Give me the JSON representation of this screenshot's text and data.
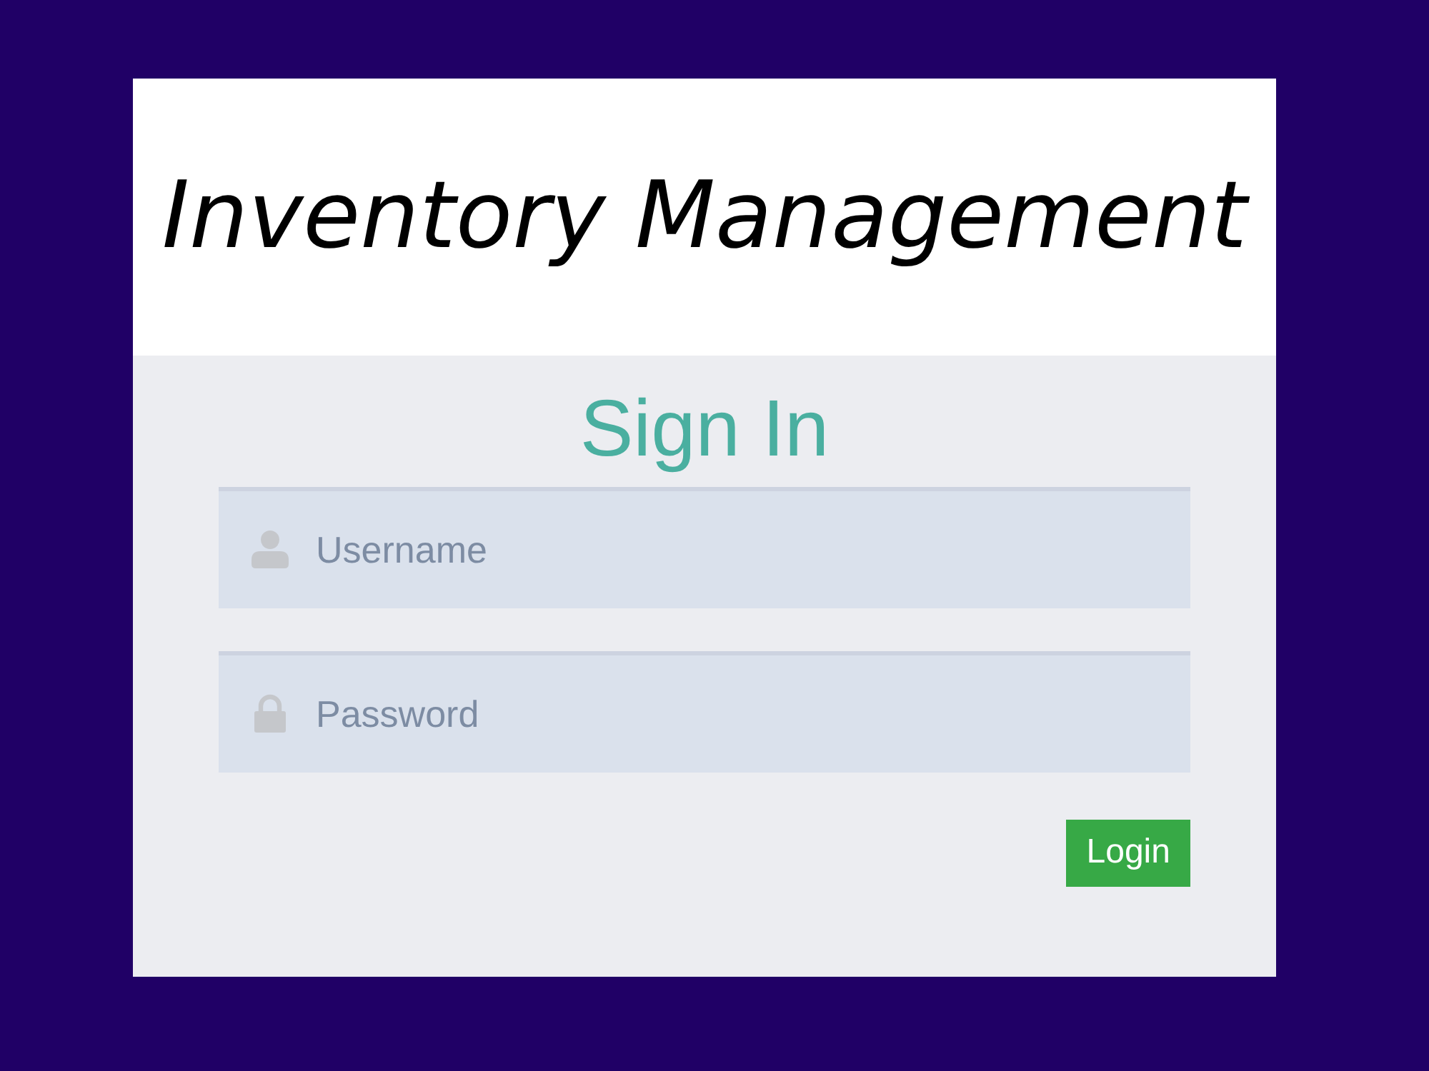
{
  "banner": {
    "title": "Inventory Management"
  },
  "form": {
    "title": "Sign In",
    "fields": [
      {
        "kind": "text",
        "placeholder": "Username"
      },
      {
        "kind": "password",
        "placeholder": "Password"
      }
    ],
    "submit": {
      "label": "Login"
    }
  }
}
